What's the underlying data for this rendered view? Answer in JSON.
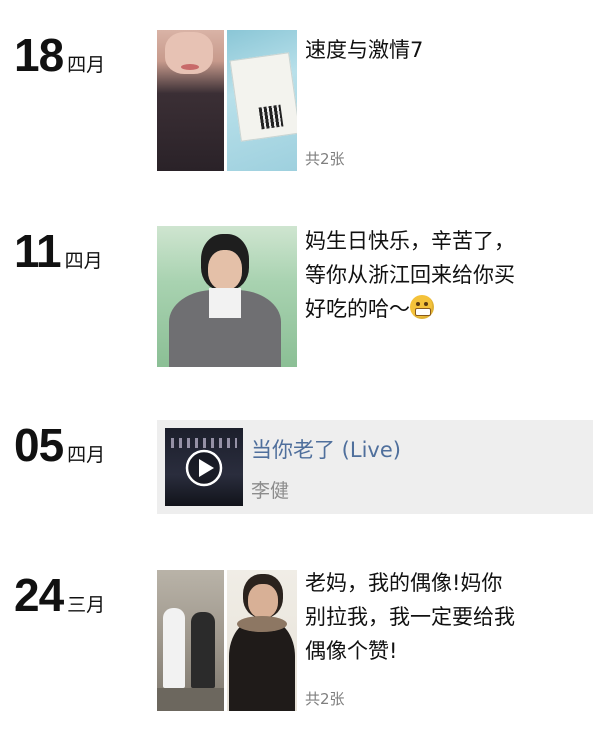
{
  "entries": [
    {
      "day": "18",
      "month": "四月",
      "text": "速度与激情7",
      "count": "共2张"
    },
    {
      "day": "11",
      "month": "四月",
      "text_lines": [
        "妈生日快乐，辛苦了，",
        "等你从浙江回来给你买",
        "好吃的哈～"
      ],
      "emoji": "grimace-emoji"
    },
    {
      "day": "05",
      "month": "四月",
      "music": {
        "title": "当你老了 (Live)",
        "artist": "李健"
      }
    },
    {
      "day": "24",
      "month": "三月",
      "text_lines": [
        "老妈，我的偶像!妈你",
        "别拉我，我一定要给我",
        "偶像个赞!"
      ],
      "count": "共2张"
    }
  ],
  "colors": {
    "link": "#4f6f9c",
    "muted": "#7f7f7f",
    "card_bg": "#eeeeee"
  }
}
